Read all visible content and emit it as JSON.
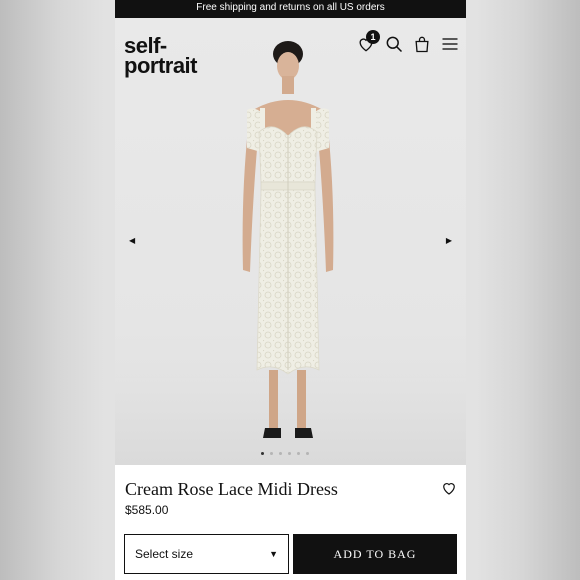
{
  "promo": {
    "text": "Free shipping and returns on all US orders"
  },
  "header": {
    "logo_line1": "self-",
    "logo_line2": "portrait",
    "wishlist_count": "1",
    "icons": [
      "wishlist-heart-icon",
      "search-icon",
      "shopping-bag-icon",
      "hamburger-menu-icon"
    ]
  },
  "gallery": {
    "prev_arrow": "◀",
    "next_arrow": "▶",
    "slide_count": 6,
    "active_slide": 1
  },
  "product": {
    "name": "Cream Rose Lace Midi Dress",
    "price": "$585.00",
    "size_placeholder": "Select size",
    "size_caret": "▼",
    "add_to_bag": "ADD TO BAG"
  }
}
